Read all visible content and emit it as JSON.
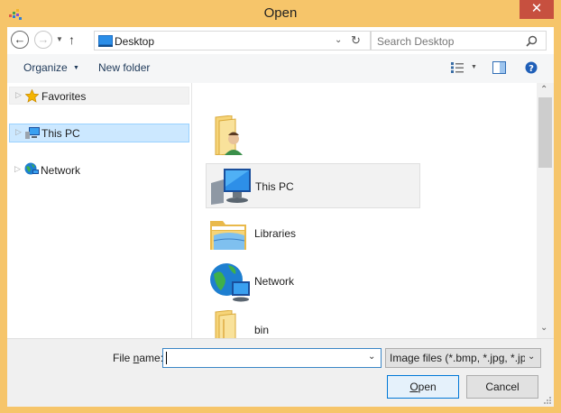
{
  "window": {
    "title": "Open",
    "close_glyph": "✕"
  },
  "address": {
    "location": "Desktop",
    "search_placeholder": "Search Desktop"
  },
  "toolbar": {
    "organize_label": "Organize",
    "new_folder_label": "New folder"
  },
  "nav_pane": {
    "items": [
      {
        "label": "Favorites",
        "icon": "star-icon"
      },
      {
        "label": "This PC",
        "icon": "computer-icon",
        "selected": true
      },
      {
        "label": "Network",
        "icon": "network-icon"
      }
    ]
  },
  "files": {
    "items": [
      {
        "label": "",
        "icon": "user-folder-icon"
      },
      {
        "label": "This PC",
        "icon": "computer-icon",
        "selected": true
      },
      {
        "label": "Libraries",
        "icon": "libraries-icon"
      },
      {
        "label": "Network",
        "icon": "network-icon"
      },
      {
        "label": "bin",
        "icon": "folder-icon"
      }
    ]
  },
  "bottom": {
    "file_name_label_pre": "File ",
    "file_name_label_accel": "n",
    "file_name_label_post": "ame:",
    "file_name_value": "",
    "file_type_value": "Image files (*.bmp, *.jpg, *.jp",
    "open_accel": "O",
    "open_rest": "pen",
    "cancel_label": "Cancel"
  },
  "colors": {
    "frame": "#f6c56a",
    "close": "#c7503f",
    "selection": "#cce8ff",
    "accent_blue": "#0078d7"
  }
}
